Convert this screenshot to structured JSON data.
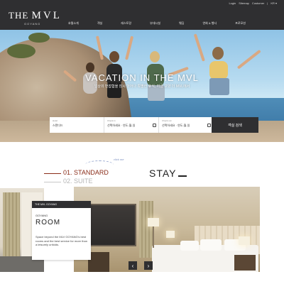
{
  "header": {
    "logo_prefix": "THE",
    "logo_name": "MVL",
    "logo_location": "GOYANG",
    "utility_links": [
      "Login",
      "Sitemap",
      "Customer",
      "|",
      "KR ▾"
    ],
    "nav": [
      "호텔소개",
      "객실",
      "레스토랑",
      "부대시설",
      "웨딩",
      "연회 & 행사",
      "프로모션"
    ]
  },
  "hero": {
    "title": "VACATION IN THE MVL",
    "subtitle": "일상의 번잡함을 잠시 벗어나 특별한 휴식, 지금 고양 더 MVL에서"
  },
  "booking": {
    "hotel": {
      "label": "Hotel",
      "value": "스탠다드"
    },
    "checkin": {
      "label": "Check in",
      "value": "선택하세요 · 연도-월-일"
    },
    "checkout": {
      "label": "Check out",
      "value": "선택하세요 · 연도-월-일"
    },
    "search_label": "객실 검색"
  },
  "stay": {
    "hint": "click me",
    "tabs": [
      "01. STANDARD",
      "02. SUITE"
    ],
    "title": "STAY"
  },
  "room_card": {
    "tag": "THE MVL GOYANG",
    "subtitle": "GOYANG",
    "title": "ROOM",
    "description": "Space beyond the MLV GOYANG's best rooms and the best service for more than a leisurely unfolds."
  },
  "colors": {
    "header_bg": "#2f2f31",
    "accent": "#8a2c18",
    "inactive_tab": "#b5b5b5"
  }
}
